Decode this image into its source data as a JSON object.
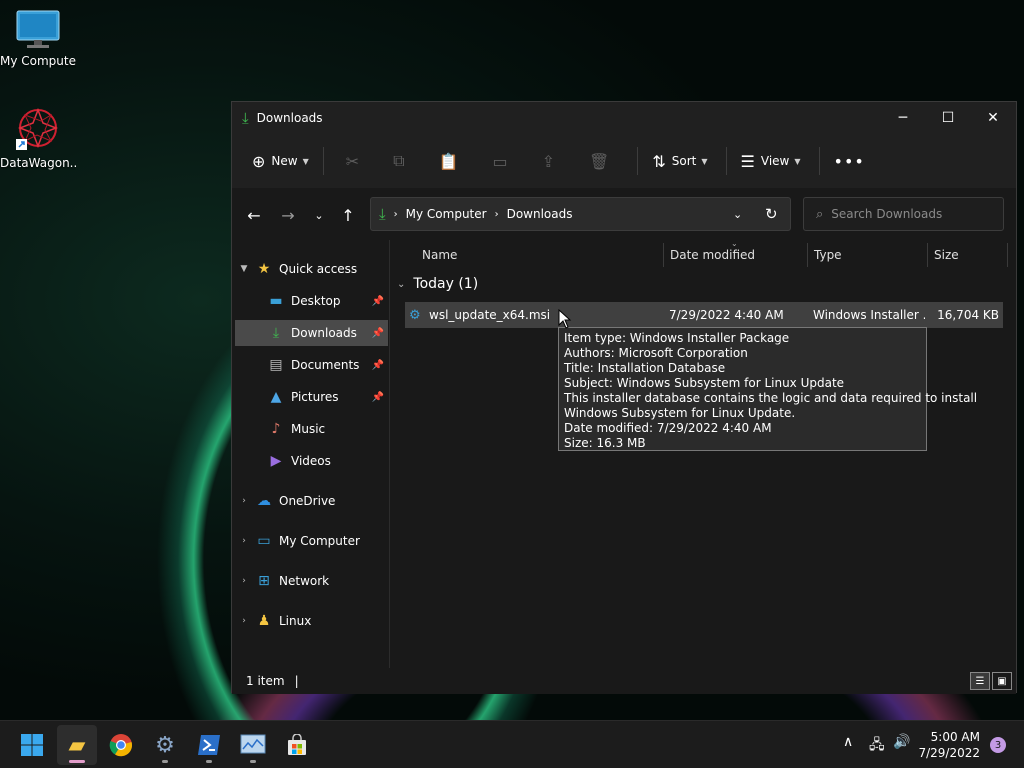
{
  "desktop": {
    "icons": [
      {
        "label": "My Computer",
        "icon": "monitor-icon"
      },
      {
        "label": "DataWagon...",
        "icon": "datawagon-shortcut-icon"
      }
    ]
  },
  "window": {
    "title": "Downloads",
    "commands": {
      "new_label": "New",
      "sort_label": "Sort",
      "view_label": "View"
    },
    "address": {
      "segments": [
        "My Computer",
        "Downloads"
      ],
      "search_placeholder": "Search Downloads"
    },
    "nav": {
      "quick_access": "Quick access",
      "items": [
        {
          "label": "Desktop",
          "icon": "desktop-folder-icon",
          "pinned": true
        },
        {
          "label": "Downloads",
          "icon": "download-icon",
          "pinned": true
        },
        {
          "label": "Documents",
          "icon": "documents-icon",
          "pinned": true
        },
        {
          "label": "Pictures",
          "icon": "pictures-icon",
          "pinned": true
        },
        {
          "label": "Music",
          "icon": "music-icon",
          "pinned": false
        },
        {
          "label": "Videos",
          "icon": "videos-icon",
          "pinned": false
        }
      ],
      "roots": [
        {
          "label": "OneDrive",
          "icon": "cloud-icon"
        },
        {
          "label": "My Computer",
          "icon": "monitor-icon"
        },
        {
          "label": "Network",
          "icon": "network-icon"
        },
        {
          "label": "Linux",
          "icon": "linux-penguin-icon"
        }
      ]
    },
    "columns": [
      "Name",
      "Date modified",
      "Type",
      "Size"
    ],
    "group_label": "Today (1)",
    "files": [
      {
        "name": "wsl_update_x64.msi",
        "date": "7/29/2022 4:40 AM",
        "type": "Windows Installer ...",
        "size": "16,704 KB"
      }
    ],
    "tooltip": [
      "Item type: Windows Installer Package",
      "Authors: Microsoft Corporation",
      "Title: Installation Database",
      "Subject: Windows Subsystem for Linux Update",
      "This installer database contains the logic and data required to install",
      "Windows Subsystem for Linux Update.",
      "Date modified: 7/29/2022 4:40 AM",
      "Size: 16.3 MB"
    ],
    "status": "1 item"
  },
  "taskbar": {
    "time": "5:00 AM",
    "date": "7/29/2022",
    "notification_count": "3"
  },
  "colors": {
    "accent_green": "#3fb950",
    "folder_yellow": "#f4c542",
    "selection": "#4a4a4a"
  }
}
